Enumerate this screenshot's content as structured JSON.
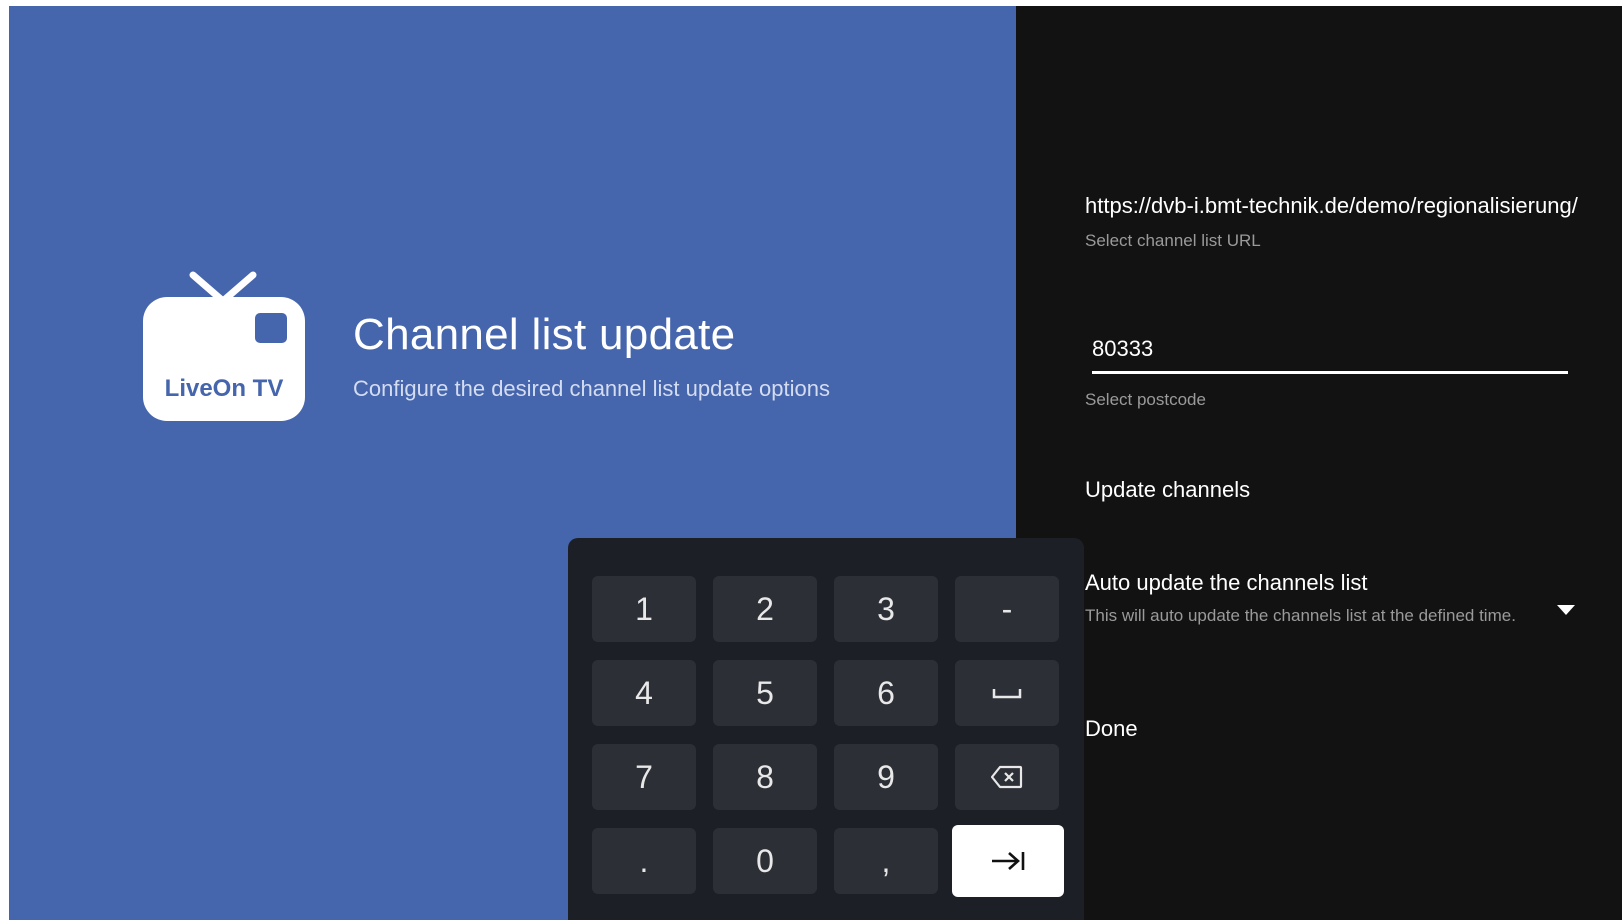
{
  "header": {
    "logo_text": "LiveOn TV",
    "title": "Channel list update",
    "subtitle": "Configure the desired channel list update options"
  },
  "settings": {
    "channel_list_url": "https://dvb-i.bmt-technik.de/demo/regionalisierung/",
    "channel_list_url_label": "Select channel list URL",
    "postcode_value": "80333",
    "postcode_label": "Select postcode",
    "update_channels_label": "Update channels",
    "auto_update_title": "Auto update the channels list",
    "auto_update_description": "This will auto update the channels list at the defined time.",
    "done_label": "Done"
  },
  "keypad": {
    "keys": [
      "1",
      "2",
      "3",
      "-",
      "4",
      "5",
      "6",
      "⎵",
      "7",
      "8",
      "9",
      "⌫",
      ".",
      "0",
      ",",
      "⇥"
    ]
  },
  "colors": {
    "left_background": "#4565ad",
    "right_background": "#121212",
    "keypad_background": "#1c1f26",
    "key_background": "#2c2f36"
  }
}
